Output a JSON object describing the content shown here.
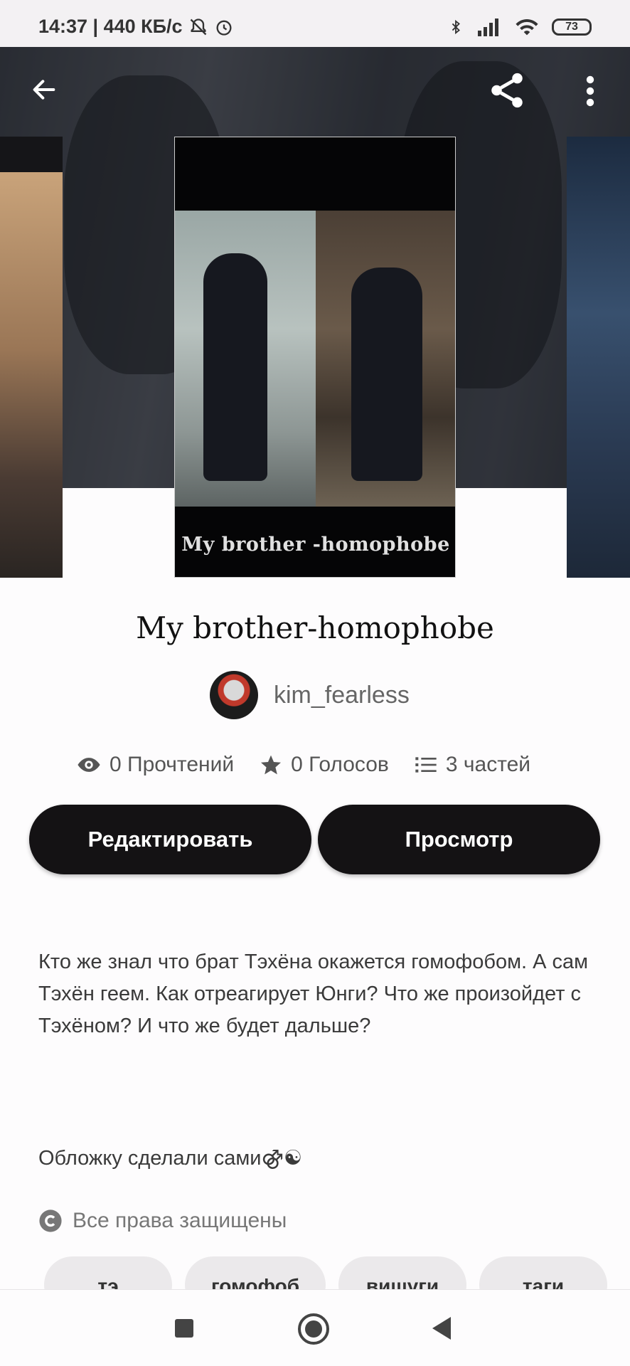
{
  "status": {
    "time_speed": "14:37 | 440 КБ/с",
    "battery": "73",
    "icons": [
      "bell-off-icon",
      "alarm-icon",
      "bluetooth-icon",
      "signal-icon",
      "wifi-icon"
    ]
  },
  "header": {
    "back_icon": "arrow-left-icon",
    "share_icon": "share-icon",
    "menu_icon": "more-vertical-icon"
  },
  "cover": {
    "caption": "My brother -homophobe"
  },
  "story": {
    "title": "My brother-homophobe",
    "author": "kim_fearless"
  },
  "stats": {
    "reads": "0 Прочтений",
    "votes": "0 Голосов",
    "parts": "3 частей"
  },
  "actions": {
    "edit": "Редактировать",
    "view": "Просмотр"
  },
  "description": {
    "text": "Кто же знал что брат Тэхёна окажется гомофобом. А сам Тэхён геем. Как отреагирует Юнги? Что же произойдет  с Тэхёном? И что же будет дальше?",
    "cover_note": "Обложку сделали сами⚣☯",
    "rights": "Все права защищены"
  },
  "tags": [
    "тэ",
    "гомофоб",
    "вишуги",
    "таги"
  ],
  "colors": {
    "button_bg": "#141214",
    "page_bg": "#fdfcfd"
  }
}
